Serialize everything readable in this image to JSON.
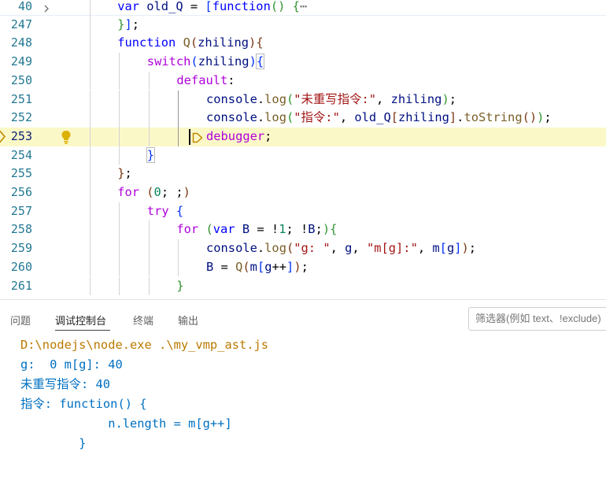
{
  "editor": {
    "lines": [
      {
        "num": "40",
        "segments": [
          {
            "t": "var ",
            "c": "kw"
          },
          {
            "t": "old_Q",
            "c": "var"
          },
          {
            "t": " = ",
            "c": ""
          },
          {
            "t": "[",
            "c": "b1"
          },
          {
            "t": "function",
            "c": "kw"
          },
          {
            "t": "()",
            "c": "b2"
          },
          {
            "t": " ",
            "c": ""
          },
          {
            "t": "{",
            "c": "b2"
          },
          {
            "t": "⋯",
            "c": "ell"
          }
        ]
      },
      {
        "num": "247",
        "segments": [
          {
            "t": "}",
            "c": "b2"
          },
          {
            "t": "]",
            "c": "b1"
          },
          {
            "t": ";",
            "c": ""
          }
        ]
      },
      {
        "num": "248",
        "segments": [
          {
            "t": "function ",
            "c": "kw"
          },
          {
            "t": "Q",
            "c": "fn"
          },
          {
            "t": "(",
            "c": "b3"
          },
          {
            "t": "zhiling",
            "c": "var"
          },
          {
            "t": ")",
            "c": "b3"
          },
          {
            "t": "{",
            "c": "b3"
          }
        ]
      },
      {
        "num": "249",
        "segments": [
          {
            "t": "switch",
            "c": "ctl"
          },
          {
            "t": "(",
            "c": "b1"
          },
          {
            "t": "zhiling",
            "c": "var"
          },
          {
            "t": ")",
            "c": "b1"
          },
          {
            "t": "{",
            "c": "b1"
          }
        ]
      },
      {
        "num": "250",
        "segments": [
          {
            "t": "default",
            "c": "ctl"
          },
          {
            "t": ":",
            "c": ""
          }
        ]
      },
      {
        "num": "251",
        "segments": [
          {
            "t": "console",
            "c": "var"
          },
          {
            "t": ".",
            "c": ""
          },
          {
            "t": "log",
            "c": "fn"
          },
          {
            "t": "(",
            "c": "b2"
          },
          {
            "t": "\"未重写指令:\"",
            "c": "str"
          },
          {
            "t": ", ",
            "c": ""
          },
          {
            "t": "zhiling",
            "c": "var"
          },
          {
            "t": ")",
            "c": "b2"
          },
          {
            "t": ";",
            "c": ""
          }
        ]
      },
      {
        "num": "252",
        "segments": [
          {
            "t": "console",
            "c": "var"
          },
          {
            "t": ".",
            "c": ""
          },
          {
            "t": "log",
            "c": "fn"
          },
          {
            "t": "(",
            "c": "b2"
          },
          {
            "t": "\"指令:\"",
            "c": "str"
          },
          {
            "t": ", ",
            "c": ""
          },
          {
            "t": "old_Q",
            "c": "var"
          },
          {
            "t": "[",
            "c": "b3"
          },
          {
            "t": "zhiling",
            "c": "var"
          },
          {
            "t": "]",
            "c": "b3"
          },
          {
            "t": ".",
            "c": ""
          },
          {
            "t": "toString",
            "c": "fn"
          },
          {
            "t": "()",
            "c": "b3"
          },
          {
            "t": ")",
            "c": "b2"
          },
          {
            "t": ";",
            "c": ""
          }
        ]
      },
      {
        "num": "253",
        "segments": [
          {
            "t": "debugger",
            "c": "ctl"
          },
          {
            "t": ";",
            "c": ""
          }
        ]
      },
      {
        "num": "254",
        "segments": [
          {
            "t": "}",
            "c": "b1"
          }
        ]
      },
      {
        "num": "255",
        "segments": [
          {
            "t": "}",
            "c": "b3"
          },
          {
            "t": ";",
            "c": ""
          }
        ]
      },
      {
        "num": "256",
        "segments": [
          {
            "t": "for ",
            "c": "ctl"
          },
          {
            "t": "(",
            "c": "b3"
          },
          {
            "t": "0",
            "c": "num"
          },
          {
            "t": "; ;",
            "c": ""
          },
          {
            "t": ")",
            "c": "b3"
          }
        ]
      },
      {
        "num": "257",
        "segments": [
          {
            "t": "try ",
            "c": "ctl"
          },
          {
            "t": "{",
            "c": "b1"
          }
        ]
      },
      {
        "num": "258",
        "segments": [
          {
            "t": "for ",
            "c": "ctl"
          },
          {
            "t": "(",
            "c": "b2"
          },
          {
            "t": "var ",
            "c": "kw"
          },
          {
            "t": "B",
            "c": "var"
          },
          {
            "t": " = !",
            "c": ""
          },
          {
            "t": "1",
            "c": "num"
          },
          {
            "t": "; !",
            "c": ""
          },
          {
            "t": "B",
            "c": "var"
          },
          {
            "t": ";",
            "c": ""
          },
          {
            "t": ")",
            "c": "b2"
          },
          {
            "t": "{",
            "c": "b2"
          }
        ]
      },
      {
        "num": "259",
        "segments": [
          {
            "t": "console",
            "c": "var"
          },
          {
            "t": ".",
            "c": ""
          },
          {
            "t": "log",
            "c": "fn"
          },
          {
            "t": "(",
            "c": "b3"
          },
          {
            "t": "\"g: \"",
            "c": "str"
          },
          {
            "t": ", ",
            "c": ""
          },
          {
            "t": "g",
            "c": "var"
          },
          {
            "t": ", ",
            "c": ""
          },
          {
            "t": "\"m[g]:\"",
            "c": "str"
          },
          {
            "t": ", ",
            "c": ""
          },
          {
            "t": "m",
            "c": "var"
          },
          {
            "t": "[",
            "c": "b1"
          },
          {
            "t": "g",
            "c": "var"
          },
          {
            "t": "]",
            "c": "b1"
          },
          {
            "t": ")",
            "c": "b3"
          },
          {
            "t": ";",
            "c": ""
          }
        ]
      },
      {
        "num": "260",
        "segments": [
          {
            "t": "B",
            "c": "var"
          },
          {
            "t": " = ",
            "c": ""
          },
          {
            "t": "Q",
            "c": "fn"
          },
          {
            "t": "(",
            "c": "b3"
          },
          {
            "t": "m",
            "c": "var"
          },
          {
            "t": "[",
            "c": "b1"
          },
          {
            "t": "g",
            "c": "var"
          },
          {
            "t": "++",
            "c": ""
          },
          {
            "t": "]",
            "c": "b1"
          },
          {
            "t": ")",
            "c": "b3"
          },
          {
            "t": ";",
            "c": ""
          }
        ]
      },
      {
        "num": "261",
        "segments": [
          {
            "t": "}",
            "c": "b2"
          }
        ]
      }
    ]
  },
  "panel": {
    "tabs": [
      "问题",
      "调试控制台",
      "终端",
      "输出"
    ],
    "active_tab": "调试控制台",
    "filter_placeholder": "筛选器(例如 text、!exclude)",
    "output": [
      {
        "text": "D:\\nodejs\\node.exe .\\my_vmp_ast.js",
        "kind": "cmd"
      },
      {
        "text": "g:  0 m[g]: 40",
        "kind": "log"
      },
      {
        "text": "未重写指令: 40",
        "kind": "log"
      },
      {
        "text": "指令: function() {",
        "kind": "log"
      },
      {
        "text": "            n.length = m[g++]",
        "kind": "log"
      },
      {
        "text": "        }",
        "kind": "log"
      }
    ]
  },
  "colors": {
    "line_number": "#237893",
    "keyword": "#0000ff",
    "control": "#af00db",
    "function": "#795e26",
    "string": "#a31515",
    "number": "#098658",
    "variable": "#001080",
    "current_line": "#fbf8c8",
    "console_log": "#0070c1",
    "console_cmd": "#ba7a00"
  },
  "icons": [
    "chevron-right-icon",
    "lightbulb-icon",
    "debug-stackframe-icon",
    "inline-breakpoint-icon"
  ]
}
